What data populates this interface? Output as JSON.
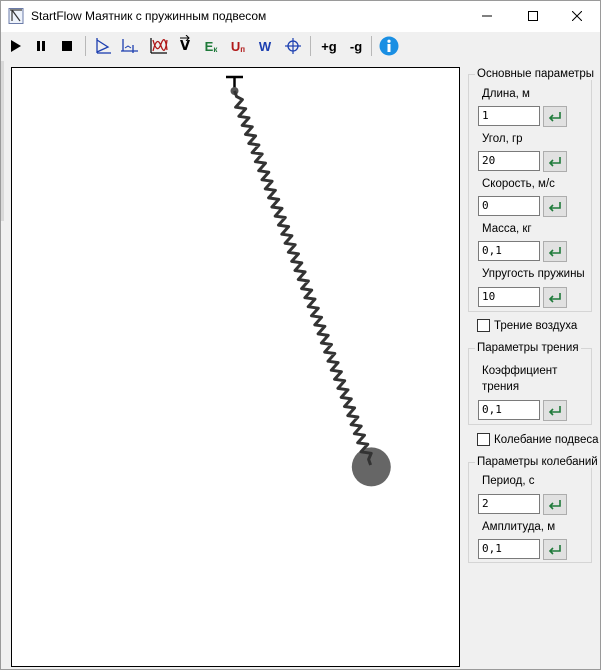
{
  "window": {
    "title": "StartFlow Маятник с пружинным подвесом",
    "minimize_glyph": "—",
    "maximize_glyph": "☐",
    "close_glyph": "✕"
  },
  "toolbar": {
    "play_icon": "play-icon",
    "pause_icon": "pause-icon",
    "stop_icon": "stop-icon",
    "plus_g": "+g",
    "minus_g": "-g",
    "v_label": "V",
    "ek_label": "E",
    "ek_sub": "к",
    "un_label": "U",
    "un_sub": "п",
    "w_label": "W"
  },
  "colors": {
    "green_icon": "#1f7a3a",
    "red_icon": "#b01818",
    "blue_icon": "#1c3fb0",
    "info_blue": "#1a8fe3",
    "spring": "#333333",
    "bob": "#666666"
  },
  "simulation": {
    "angle_deg": 20
  },
  "main_params": {
    "title": "Основные параметры",
    "length_label": "Длина, м",
    "length_value": "1",
    "angle_label": "Угол, гр",
    "angle_value": "20",
    "speed_label": "Скорость, м/с",
    "speed_value": "0",
    "mass_label": "Масса, кг",
    "mass_value": "0,1",
    "stiffness_label": "Упругость пружины",
    "stiffness_value": "10"
  },
  "air_friction": {
    "label": "Трение воздуха",
    "checked": false
  },
  "friction_params": {
    "title": "Параметры трения",
    "coef_label_line1": "Коэффициент",
    "coef_label_line2": "трения",
    "coef_value": "0,1"
  },
  "suspension_oscillation": {
    "label": "Колебание подвеса",
    "checked": false
  },
  "oscillation_params": {
    "title": "Параметры колебаний",
    "period_label": "Период, с",
    "period_value": "2",
    "amplitude_label": "Амплитуда, м",
    "amplitude_value": "0,1"
  }
}
